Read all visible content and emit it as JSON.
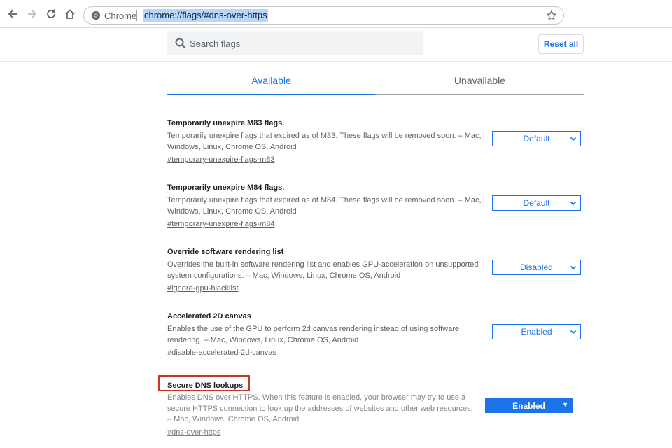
{
  "browser": {
    "site_label": "Chrome",
    "url": "chrome://flags/#dns-over-https"
  },
  "header": {
    "search_placeholder": "Search flags",
    "reset_label": "Reset all"
  },
  "tabs": [
    {
      "label": "Available",
      "active": true
    },
    {
      "label": "Unavailable",
      "active": false
    }
  ],
  "flags": [
    {
      "title": "Temporarily unexpire M83 flags.",
      "description": "Temporarily unexpire flags that expired as of M83. These flags will be removed soon. – Mac, Windows, Linux, Chrome OS, Android",
      "link": "#temporary-unexpire-flags-m83",
      "value": "Default"
    },
    {
      "title": "Temporarily unexpire M84 flags.",
      "description": "Temporarily unexpire flags that expired as of M84. These flags will be removed soon. – Mac, Windows, Linux, Chrome OS, Android",
      "link": "#temporary-unexpire-flags-m84",
      "value": "Default"
    },
    {
      "title": "Override software rendering list",
      "description": "Overrides the built-in software rendering list and enables GPU-acceleration on unsupported system configurations. – Mac, Windows, Linux, Chrome OS, Android",
      "link": "#ignore-gpu-blacklist",
      "value": "Disabled"
    },
    {
      "title": "Accelerated 2D canvas",
      "description": "Enables the use of the GPU to perform 2d canvas rendering instead of using software rendering. – Mac, Windows, Linux, Chrome OS, Android",
      "link": "#disable-accelerated-2d-canvas",
      "value": "Enabled"
    },
    {
      "title": "Secure DNS lookups",
      "description": "Enables DNS over HTTPS. When this feature is enabled, your browser may try to use a secure HTTPS connection to look up the addresses of websites and other web resources. – Mac, Windows, Chrome OS, Android",
      "link": "#dns-over-https",
      "value": "Enabled"
    }
  ],
  "colors": {
    "accent": "#1a73e8",
    "highlight": "#c0392b"
  }
}
